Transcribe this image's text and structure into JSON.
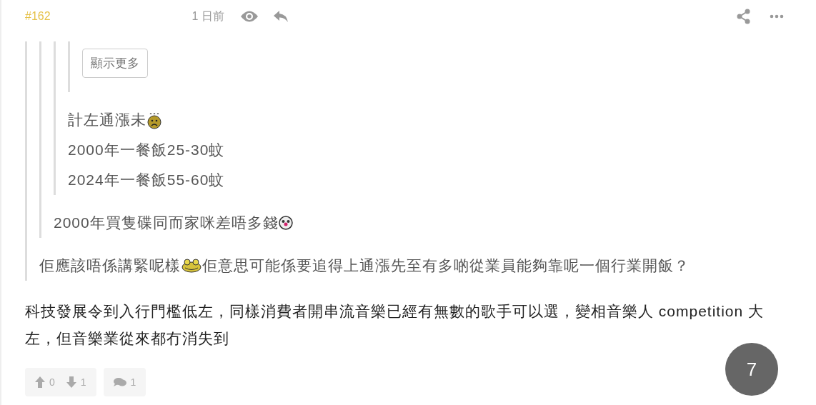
{
  "header": {
    "post_number": "#162",
    "time": "1 日前"
  },
  "quote": {
    "quote": {
      "quote": {
        "quote": {
          "show_more": "顯示更多"
        },
        "lines": [
          [
            {
              "kind": "text",
              "text": "計左通漲未"
            },
            {
              "kind": "sad-emoji"
            }
          ],
          [
            {
              "kind": "text",
              "text": "2000年一餐飯25-30蚊"
            }
          ],
          [
            {
              "kind": "text",
              "text": "2024年一餐飯55-60蚊"
            }
          ]
        ]
      },
      "lines": [
        [
          {
            "kind": "text",
            "text": "2000年買隻碟同而家咪差唔多錢"
          },
          {
            "kind": "clown-emoji"
          }
        ]
      ]
    },
    "lines": [
      [
        {
          "kind": "text",
          "text": "佢應該唔係講緊呢樣"
        },
        {
          "kind": "frog-emoji"
        },
        {
          "kind": "text",
          "text": "佢意思可能係要追得上通漲先至有多啲從業員能夠靠呢一個行業開飯？"
        }
      ]
    ]
  },
  "body": "科技發展令到入行門檻低左，同樣消費者開串流音樂已經有無數的歌手可以選，變相音樂人 competition 大左，但音樂業從來都冇消失到",
  "footer": {
    "upvotes": "0",
    "downvotes": "1",
    "comments": "1",
    "page": "7"
  }
}
